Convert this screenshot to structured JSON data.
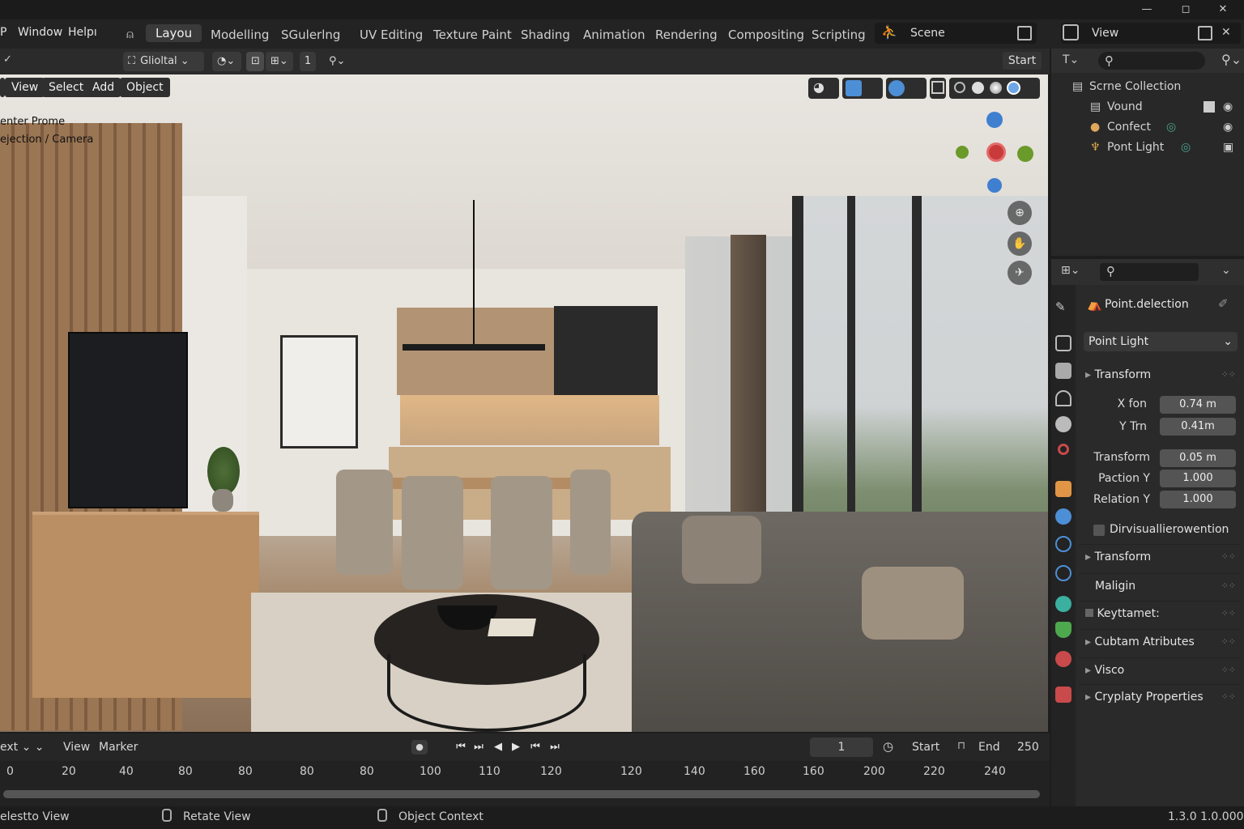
{
  "window_controls": {
    "minimize": "—",
    "maximize": "◻",
    "close": "✕"
  },
  "menus": [
    "Window",
    "Helpı"
  ],
  "workspaces": [
    "Layou",
    "Modelling",
    "SGulerlng",
    "UV Editing",
    "Texture Paint",
    "Shading",
    "Animation",
    "Rendering",
    "Compositing",
    "Scripting"
  ],
  "active_workspace": "Layou",
  "scene_label": "Scene",
  "view_label": "View",
  "toolbar": {
    "orientation": "Glioltal",
    "snap_count": "1",
    "start_button": "Start"
  },
  "viewport_menu": [
    "View",
    "Select",
    "Add",
    "Object"
  ],
  "viewport_overlay": {
    "line1": "enter Prome",
    "line2": "ejection / Camera"
  },
  "outliner": {
    "title": "Scrne Collection",
    "items": [
      {
        "label": "Vound",
        "icon": "collection-icon"
      },
      {
        "label": "Confect",
        "icon": "light-icon"
      },
      {
        "label": "Pont Light",
        "icon": "pointlight-icon"
      }
    ]
  },
  "properties": {
    "object_name": "Point.delection",
    "type_dropdown": "Point Light",
    "transform_header": "Transform",
    "fields": [
      {
        "label": "X fon",
        "value": "0.74 m"
      },
      {
        "label": "Y Trn",
        "value": "0.41m"
      },
      {
        "label": "Transform",
        "value": "0.05 m"
      },
      {
        "label": "Paction Y",
        "value": "1.000"
      },
      {
        "label": "Relation Y",
        "value": "1.000"
      }
    ],
    "checkbox_label": "Dirvisuallierowention",
    "sections": [
      "Transform",
      "Maligin",
      "Keyttamet:",
      "Cubtam Atributes",
      "Visco",
      "Cryplaty Properties"
    ]
  },
  "timeline": {
    "mode": "ext",
    "menu": [
      "View",
      "Marker"
    ],
    "current_frame": "1",
    "start_label": "Start",
    "end_label": "End",
    "end_value": "250",
    "ticks": [
      "0",
      "20",
      "40",
      "80",
      "80",
      "80",
      "80",
      "100",
      "110",
      "120",
      "120",
      "140",
      "160",
      "160",
      "200",
      "220",
      "240"
    ]
  },
  "statusbar": {
    "left": "elestto View",
    "middle": "Retate View",
    "right_ctx": "Object Context",
    "version": "1.3.0 1.0.000"
  },
  "colors": {
    "accent_blue": "#4d8fd6",
    "gizmo_red": "#c93b3b",
    "gizmo_green": "#6a9a2a"
  }
}
